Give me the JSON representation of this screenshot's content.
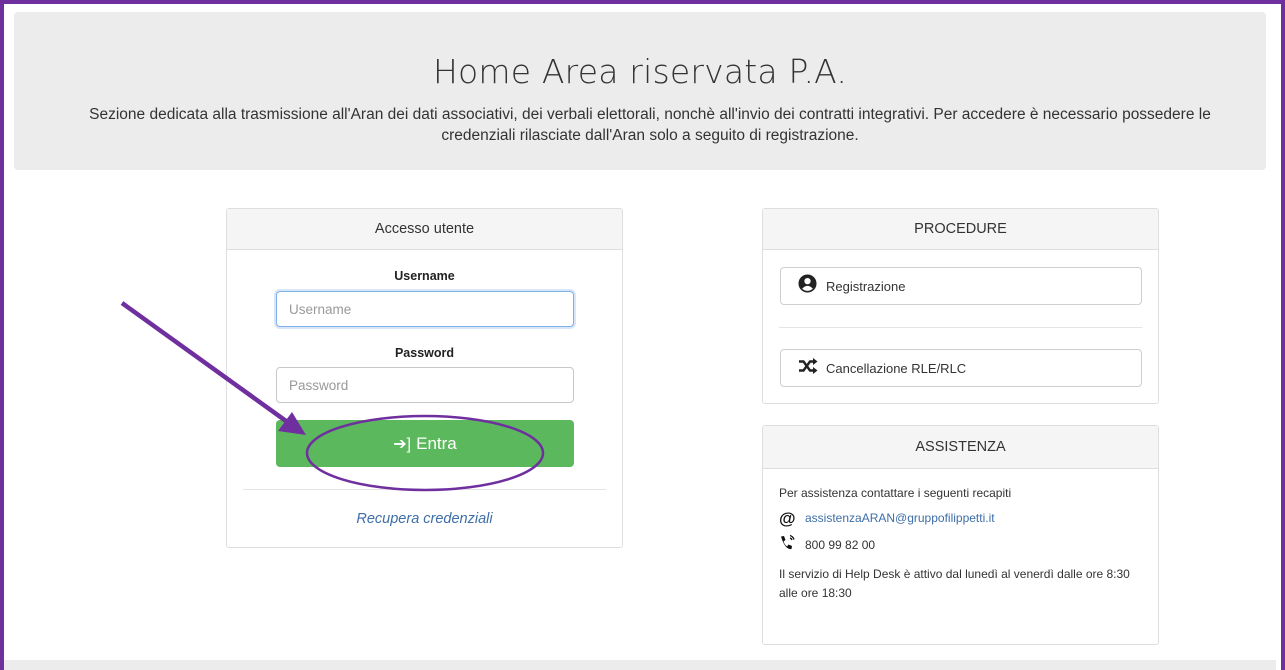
{
  "hero": {
    "title": "Home Area riservata P.A.",
    "description": "Sezione dedicata alla trasmissione all'Aran dei dati associativi, dei verbali elettorali, nonchè all'invio dei contratti integrativi. Per accedere è necessario possedere le credenziali rilasciate dall'Aran solo a seguito di registrazione."
  },
  "login": {
    "heading": "Accesso utente",
    "username_label": "Username",
    "username_placeholder": "Username",
    "password_label": "Password",
    "password_placeholder": "Password",
    "enter_label": "Entra",
    "recover_label": "Recupera credenziali"
  },
  "procedure": {
    "heading": "PROCEDURE",
    "items": [
      {
        "label": "Registrazione",
        "icon": "user-circle-icon"
      },
      {
        "label": "Cancellazione RLE/RLC",
        "icon": "shuffle-icon"
      }
    ]
  },
  "assistenza": {
    "heading": "ASSISTENZA",
    "intro": "Per assistenza contattare i seguenti recapiti",
    "email": "assistenzaARAN@gruppofilippetti.it",
    "phone": "800 99 82 00",
    "hours": "Il servizio di Help Desk è attivo dal lunedì al venerdì dalle ore 8:30 alle ore 18:30"
  },
  "colors": {
    "frame": "#6f2f9f",
    "enter_button": "#5cb85c",
    "link": "#3d6ea8",
    "annotation": "#6f2f9f"
  }
}
